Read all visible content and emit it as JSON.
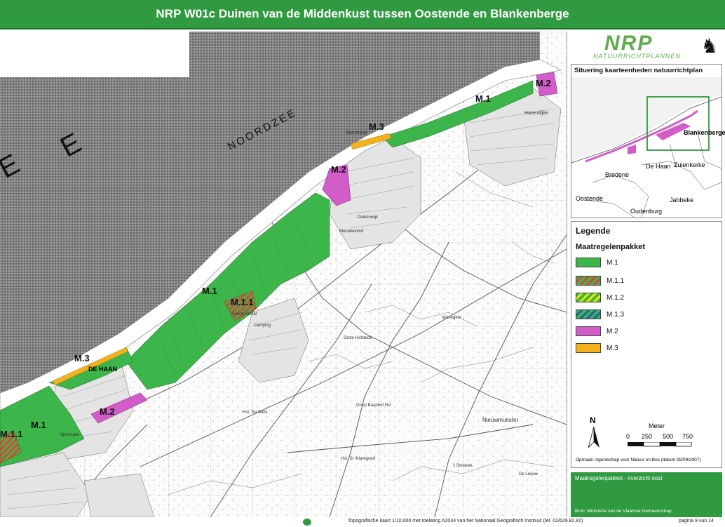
{
  "title": "NRP W01c Duinen van de Middenkust tussen Oostende en Blankenberge",
  "map": {
    "sea_name": "NOORDZEE",
    "sea_letters": [
      "E",
      "E"
    ],
    "zone_labels": {
      "m1_east": "M.1",
      "m2_east": "M.2",
      "m3_wenduine": "M.3",
      "m2_wenduine": "M.2",
      "m1_mid": "M.1",
      "m11_mid": "M.1.1",
      "m3_dehaan": "M.3",
      "m2_west": "M.2",
      "m1_west": "M.1",
      "m11_west": "M.1.1"
    },
    "place_names": {
      "de_haan": "DE HAAN",
      "wenduine": "Wenduine",
      "harendijke": "Harendijke",
      "nieuwmunster": "Nieuwmunster",
      "camping": "Camping",
      "grote_hofstede": "Grote Hofstede",
      "vlissegem_station": "Vlissegem",
      "zwarte_kiezel": "Zwarte Kiezel",
      "spermalie": "Spermalie",
      "monnikenhof": "Monnikenhof",
      "groot_baanhof": "Groot Baanhof Hst",
      "hof_ter_biest": "Hst. Ter Biest",
      "kleine_klaregoed": "Hst. St.-Klaregoed",
      "smisken": "'t Smisken",
      "de_leeuw": "De Leeuw",
      "dvelpje": "Duinenwijk"
    }
  },
  "logo": {
    "name": "NRP",
    "subtitle": "NATUURRICHTPLANNEN"
  },
  "inset": {
    "title": "Situering kaarteenheden natuurrichtplan",
    "places": [
      "Blankenberge",
      "De Haan",
      "Bredene",
      "Zuienkerke",
      "Oostende",
      "Jabbeke",
      "Oudenburg"
    ]
  },
  "legend": {
    "title": "Legende",
    "subtitle": "Maatregelenpakket",
    "items": [
      {
        "label": "M.1",
        "color": "#3cb54a"
      },
      {
        "label": "M.1.1",
        "color": "#3cb54a",
        "stripe": "#e0463a"
      },
      {
        "label": "M.1.2",
        "color": "#3cb54a",
        "stripe": "#f2e600"
      },
      {
        "label": "M.1.3",
        "color": "#3cb54a",
        "stripe": "#2a5ab8"
      },
      {
        "label": "M.2",
        "color": "#d25cc8"
      },
      {
        "label": "M.3",
        "color": "#f3b21c"
      }
    ],
    "north": "N",
    "scale_unit": "Meter",
    "scale_ticks": [
      "0",
      "250",
      "500",
      "750"
    ],
    "credits": "Opmaak: Agentschap voor Natuur en Bos (datum 05/09/2007)"
  },
  "footer": {
    "caption": "Maatregelenpakket - overzicht oost",
    "source": "Bron: Ministerie van de Vlaamse Gemeenschap",
    "topo_note": "Topografische kaart 1/10.000 met toelating A2044 van het Nationaal Geografisch Instituut (tel. 02/629.82.82)",
    "page": "pagina 9 van 14"
  },
  "colors": {
    "title_green": "#2f9a3f",
    "zone_green": "#3cb54a",
    "zone_pink": "#d25cc8",
    "zone_orange": "#f3b21c",
    "hatch_red": "#e0463a",
    "sea_gray": "#8a8a8a"
  }
}
